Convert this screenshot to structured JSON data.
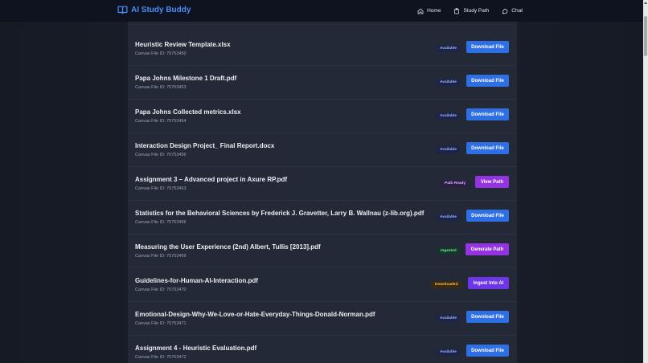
{
  "app": {
    "title": "AI Study Buddy",
    "accent": "#4a8ef7"
  },
  "nav": [
    {
      "label": "Home",
      "icon": "home-icon"
    },
    {
      "label": "Study Path",
      "icon": "clipboard-icon"
    },
    {
      "label": "Chat",
      "icon": "chat-bubble-icon"
    }
  ],
  "files": [
    {
      "name": "Heuristic Review Template.xlsx",
      "id": "Canvas File ID: 70753450",
      "status": "Available",
      "action": "Download File"
    },
    {
      "name": "Papa Johns Milestone 1 Draft.pdf",
      "id": "Canvas File ID: 70753453",
      "status": "Available",
      "action": "Download File"
    },
    {
      "name": "Papa Johns Collected metrics.xlsx",
      "id": "Canvas File ID: 70753454",
      "status": "Available",
      "action": "Download File"
    },
    {
      "name": "Interaction Design Project_ Final Report.docx",
      "id": "Canvas File ID: 70753456",
      "status": "Available",
      "action": "Download File"
    },
    {
      "name": "Assignment 3 – Advanced project in Axure RP.pdf",
      "id": "Canvas File ID: 70753463",
      "status": "Path Ready",
      "action": "View Path"
    },
    {
      "name": "Statistics for the Behavioral Sciences by Frederick J. Gravetter, Larry B. Wallnau (z-lib.org).pdf",
      "id": "Canvas File ID: 70753466",
      "status": "Available",
      "action": "Download File"
    },
    {
      "name": "Measuring the User Experience (2nd) Albert, Tullis [2013].pdf",
      "id": "Canvas File ID: 70753469",
      "status": "Ingested",
      "action": "Generate Path"
    },
    {
      "name": "Guidelines-for-Human-AI-Interaction.pdf",
      "id": "Canvas File ID: 70753470",
      "status": "Downloaded",
      "action": "Ingest into AI"
    },
    {
      "name": "Emotional-Design-Why-We-Love-or-Hate-Everyday-Things-Donald-Norman.pdf",
      "id": "Canvas File ID: 70753471",
      "status": "Available",
      "action": "Download File"
    },
    {
      "name": "Assignment 4 - Heuristic Evaluation.pdf",
      "id": "Canvas File ID: 70753472",
      "status": "Available",
      "action": "Download File"
    }
  ]
}
